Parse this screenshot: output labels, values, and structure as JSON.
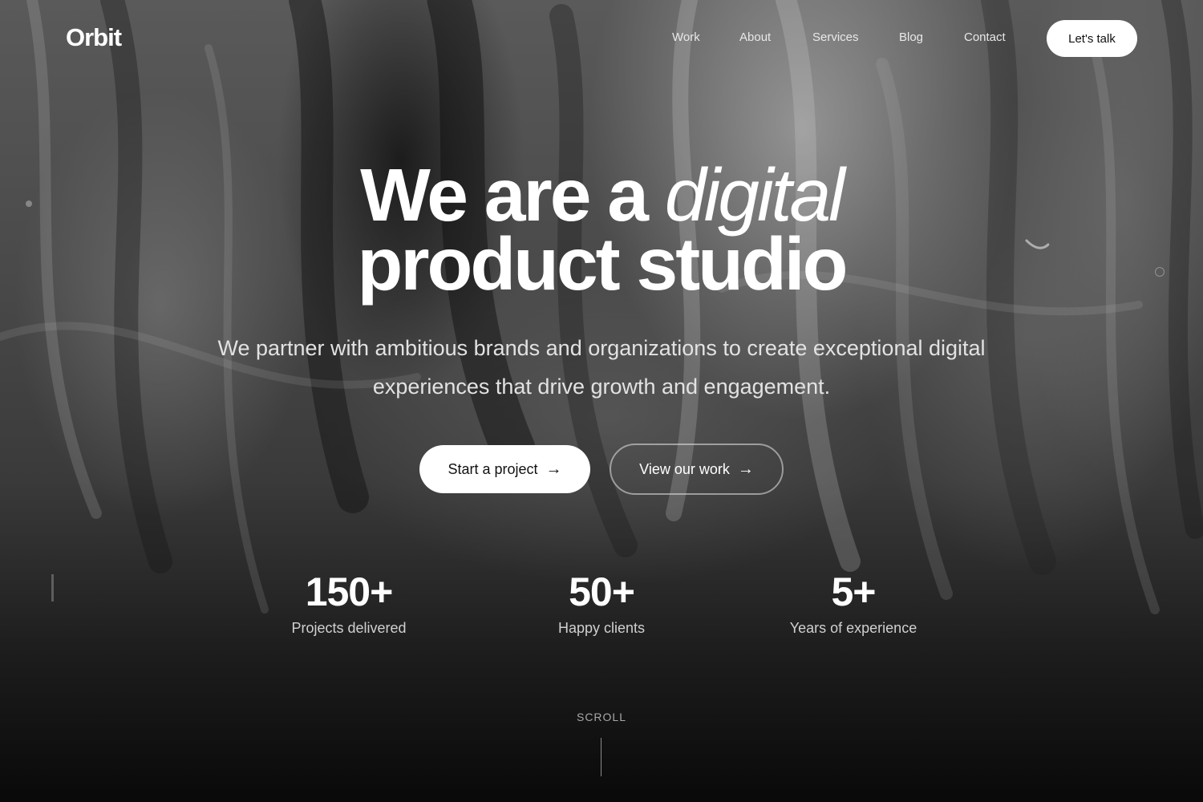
{
  "brand": {
    "logo": "Orbit"
  },
  "nav": {
    "links": [
      "Work",
      "About",
      "Services",
      "Blog",
      "Contact"
    ],
    "cta": "Let's talk"
  },
  "hero": {
    "headline_part1": "We are a",
    "headline_italic": "digital",
    "headline_line2": "product studio",
    "subtitle": "We partner with ambitious brands and organizations to create exceptional digital experiences that drive growth and engagement.",
    "primary_button": "Start a project",
    "secondary_button": "View our work",
    "arrow_glyph": "→"
  },
  "stats": [
    {
      "value": "150+",
      "label": "Projects delivered"
    },
    {
      "value": "50+",
      "label": "Happy clients"
    },
    {
      "value": "5+",
      "label": "Years of experience"
    }
  ],
  "scroll": {
    "label": "SCROLL"
  },
  "colors": {
    "background": "#0b0b0b",
    "text": "#ffffff",
    "button_bg": "#ffffff",
    "button_text": "#111111"
  },
  "icons": {
    "arrow": "arrow-right-icon"
  }
}
